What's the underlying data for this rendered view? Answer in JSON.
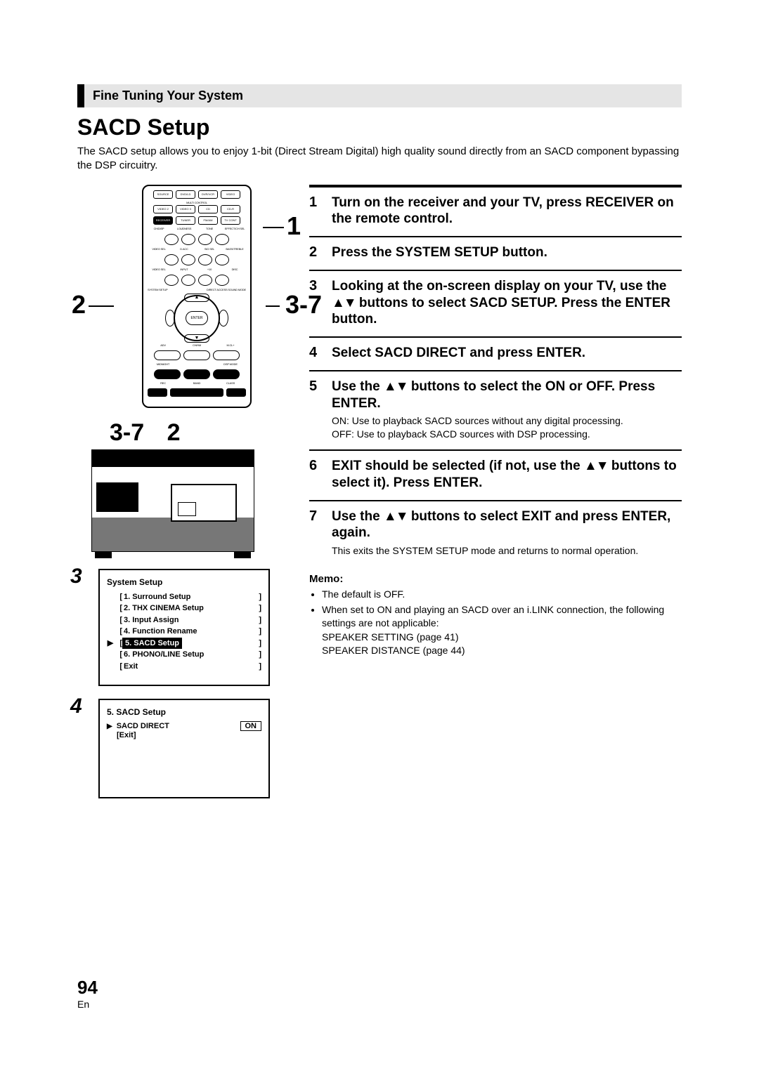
{
  "breadcrumb": "Fine Tuning Your System",
  "title": "SACD Setup",
  "intro": "The SACD setup allows you to enjoy 1-bit (Direct Stream Digital) high quality sound directly from an SACD component bypassing the DSP circuitry.",
  "remote_callouts": {
    "c1": "1",
    "c2": "2",
    "c37": "3-7"
  },
  "unit_callouts": {
    "c37": "3-7",
    "c2": "2"
  },
  "remote": {
    "row1": [
      "SOURCE",
      "DVD/LD",
      "DVR/VCR",
      "VIDEO"
    ],
    "multi": "MULTI CONTROL",
    "row2": [
      "VIDEO 2",
      "VIDEO 3",
      "CD",
      "CD-R"
    ],
    "row3": [
      "RECEIVER",
      "TUNER",
      "FM/AM",
      "TV CONT"
    ],
    "row5l": [
      "CH/DISP",
      "LOUDNESS",
      "TONE",
      "EFFECT/CH SEL"
    ],
    "row6l": [
      "VIDEO SEL",
      "D.ACC",
      "SIG SEL",
      "BASS/TREBLE"
    ],
    "row7l": [
      "VIDEO SEL",
      "INPUT",
      "+10",
      "DISC"
    ],
    "left_btn": "SYSTEM SETUP",
    "right_btn": "DIRECT ACCESS SOUND MODE",
    "nav_center": "ENTER",
    "adv": "ADV",
    "chhm": "CH/HM",
    "mcl": "M.CL+",
    "midi": "MIDNIGHT",
    "dsp": "DSP MODE",
    "rec": "REC",
    "band": "BAND",
    "class": "CLASS"
  },
  "osd3": {
    "num": "3",
    "title": "System Setup",
    "items": [
      {
        "label": "1. Surround Setup",
        "selected": false
      },
      {
        "label": "2. THX CINEMA Setup",
        "selected": false
      },
      {
        "label": "3. Input Assign",
        "selected": false
      },
      {
        "label": "4. Function Rename",
        "selected": false
      },
      {
        "label": "5. SACD Setup",
        "selected": true
      },
      {
        "label": "6. PHONO/LINE Setup",
        "selected": false
      },
      {
        "label": "Exit",
        "selected": false
      }
    ]
  },
  "osd4": {
    "num": "4",
    "title": "5. SACD Setup",
    "row_label": "SACD DIRECT",
    "row_value": "ON",
    "exit": "[Exit]"
  },
  "steps": [
    {
      "n": "1",
      "title": "Turn on the receiver and your TV, press RECEIVER on the remote control."
    },
    {
      "n": "2",
      "title": "Press the SYSTEM SETUP button."
    },
    {
      "n": "3",
      "title_pre": "Looking at the on-screen display on your TV, use the ",
      "title_post": " buttons to select SACD SETUP. Press the ENTER button.",
      "arrows": true
    },
    {
      "n": "4",
      "title": "Select SACD DIRECT and press ENTER."
    },
    {
      "n": "5",
      "title_pre": "Use the ",
      "title_post": " buttons to select the ON or OFF. Press ENTER.",
      "arrows": true,
      "desc": "ON: Use to playback SACD sources without any digital processing.\nOFF: Use to playback SACD sources with DSP processing."
    },
    {
      "n": "6",
      "title_pre": "EXIT should be selected (if not, use the ",
      "title_post": " buttons to select it). Press ENTER.",
      "arrows": true
    },
    {
      "n": "7",
      "title_pre": "Use the ",
      "title_post": " buttons to select EXIT and press ENTER, again.",
      "arrows": true,
      "desc": "This exits the SYSTEM SETUP mode and returns to normal operation."
    }
  ],
  "memo_h": "Memo:",
  "memo": [
    "The default is OFF.",
    "When set to ON and playing an SACD over an i.LINK connection, the following settings are not applicable:\nSPEAKER SETTING (page 41)\nSPEAKER DISTANCE (page 44)"
  ],
  "page_number": "94",
  "page_lang": "En",
  "arrows_glyph": "▲▼"
}
